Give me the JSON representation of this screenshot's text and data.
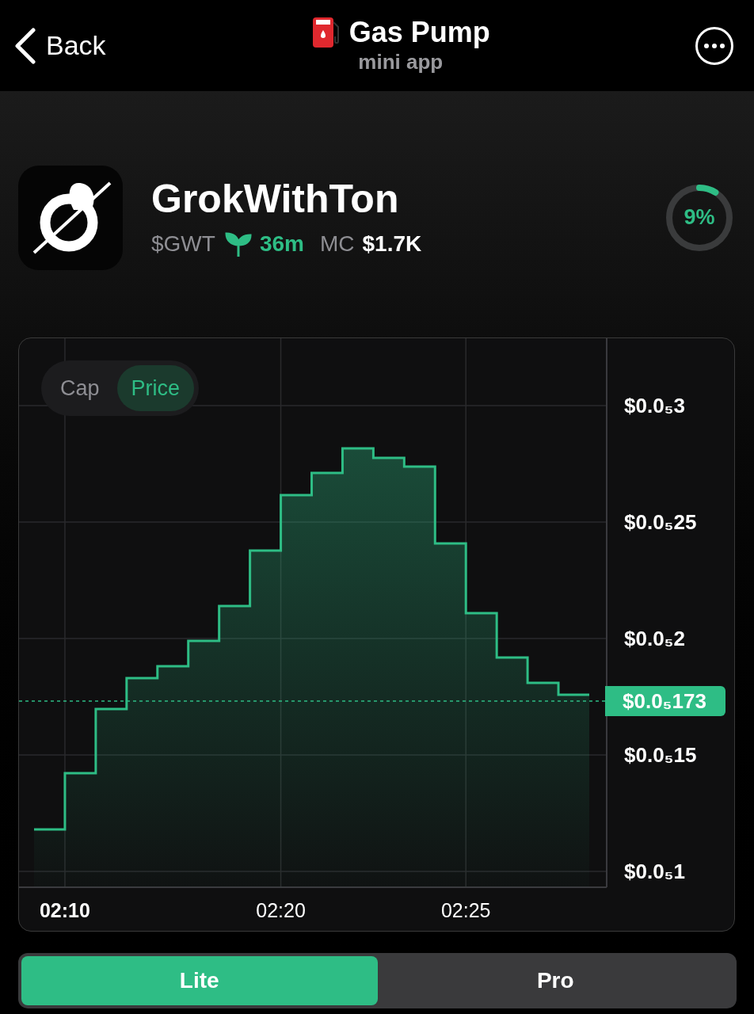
{
  "header": {
    "back": "Back",
    "title": "Gas Pump",
    "subtitle": "mini app"
  },
  "token": {
    "name": "GrokWithTon",
    "ticker": "$GWT",
    "age": "36m",
    "mc_label": "MC",
    "mc_value": "$1.7K",
    "progress": {
      "level": 0.09,
      "label": "9%"
    }
  },
  "chart": {
    "toggle": [
      {
        "label": "Cap",
        "selected": false
      },
      {
        "label": "Price",
        "selected": true
      }
    ],
    "y_labels": [
      "$0.0₅3",
      "$0.0₅25",
      "$0.0₅2",
      "$0.0₅15",
      "$0.0₅1"
    ],
    "current_price": "$0.0₅173",
    "x_labels": [
      "02:10",
      "02:20",
      "02:25"
    ]
  },
  "modes": [
    {
      "label": "Lite",
      "selected": true
    },
    {
      "label": "Pro",
      "selected": false
    }
  ]
}
